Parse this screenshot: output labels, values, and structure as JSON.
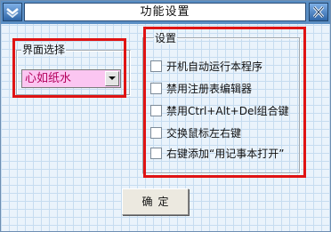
{
  "window": {
    "title": "功能设置"
  },
  "titlebar": {
    "left_icon": "app-icon",
    "right_icon": "close-icon"
  },
  "appearance_group": {
    "label": "界面选择",
    "selected_theme": "心如纸水"
  },
  "settings_group": {
    "label": "设置",
    "options": [
      {
        "label": "开机自动运行本程序",
        "checked": false
      },
      {
        "label": "禁用注册表编辑器",
        "checked": false
      },
      {
        "label": "禁用Ctrl+Alt+Del组合键",
        "checked": false
      },
      {
        "label": "交换鼠标左右键",
        "checked": false
      },
      {
        "label": "右键添加“用记事本打开”",
        "checked": false
      }
    ]
  },
  "buttons": {
    "ok_label": "确定"
  },
  "colors": {
    "titlebar": "#5a8ec4",
    "highlight_box": "#e01313",
    "combo_background": "#fbc6f1",
    "combo_text": "#b4005b"
  }
}
